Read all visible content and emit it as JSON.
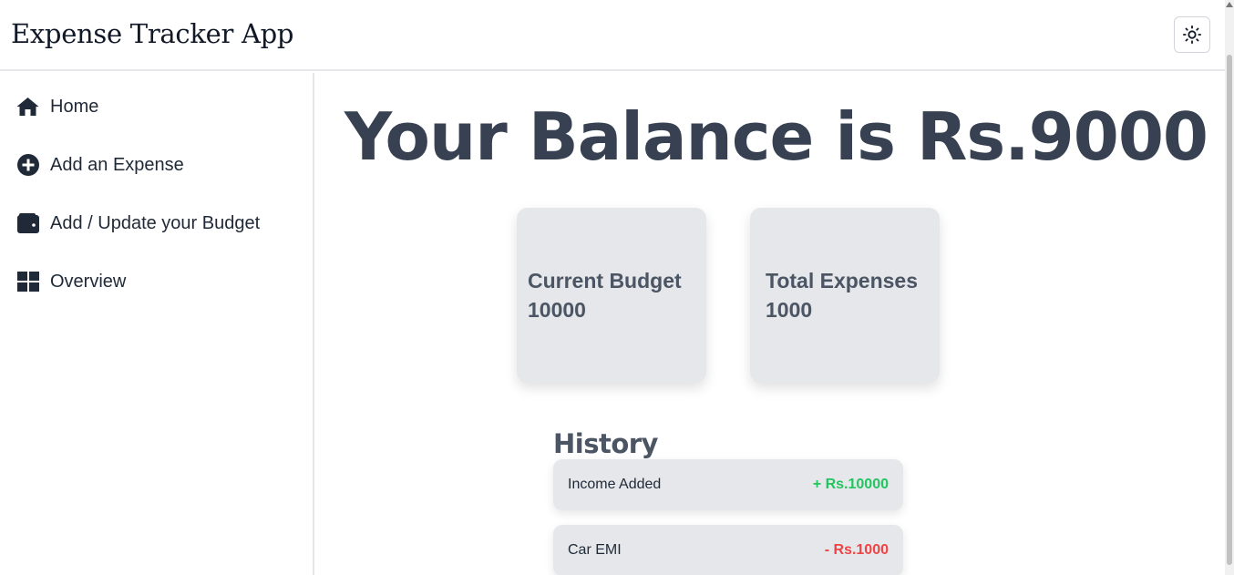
{
  "header": {
    "title": "Expense Tracker App",
    "theme_icon": "sun-icon"
  },
  "sidebar": {
    "items": [
      {
        "label": "Home",
        "icon": "home-icon"
      },
      {
        "label": "Add an Expense",
        "icon": "plus-circle-icon"
      },
      {
        "label": "Add / Update your Budget",
        "icon": "wallet-icon"
      },
      {
        "label": "Overview",
        "icon": "grid-icon"
      }
    ]
  },
  "main": {
    "balance_text": "Your Balance is Rs.9000",
    "cards": [
      {
        "label": "Current Budget",
        "value": "10000"
      },
      {
        "label": "Total Expenses",
        "value": "1000"
      }
    ],
    "history": {
      "title": "History",
      "rows": [
        {
          "name": "Income Added",
          "amount": "+ Rs.10000",
          "color": "#22c55e"
        },
        {
          "name": "Car EMI",
          "amount": "- Rs.1000",
          "color": "#ef4444"
        }
      ]
    }
  }
}
